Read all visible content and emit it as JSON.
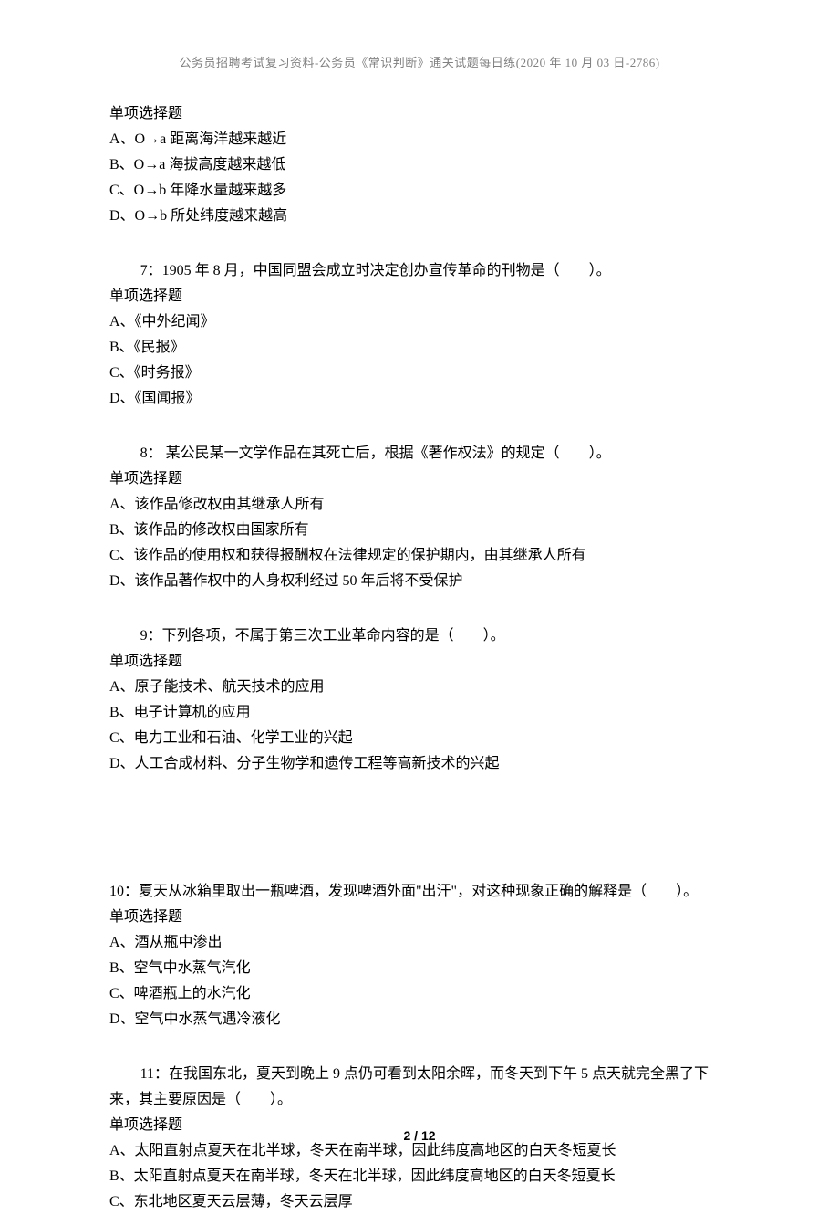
{
  "header": "公务员招聘考试复习资料-公务员《常识判断》通关试题每日练(2020 年 10 月 03 日-2786)",
  "q6": {
    "type": "单项选择题",
    "a": "A、O→a 距离海洋越来越近",
    "b": "B、O→a 海拔高度越来越低",
    "c": "C、O→b 年降水量越来越多",
    "d": "D、O→b 所处纬度越来越高"
  },
  "q7": {
    "text": "7：1905 年 8 月，中国同盟会成立时决定创办宣传革命的刊物是（　　）。",
    "type": "单项选择题",
    "a": "A、《中外纪闻》",
    "b": "B、《民报》",
    "c": "C、《时务报》",
    "d": "D、《国闻报》"
  },
  "q8": {
    "text": "8： 某公民某一文学作品在其死亡后，根据《著作权法》的规定（　　）。",
    "type": "单项选择题",
    "a": "A、该作品修改权由其继承人所有",
    "b": "B、该作品的修改权由国家所有",
    "c": "C、该作品的使用权和获得报酬权在法律规定的保护期内，由其继承人所有",
    "d": "D、该作品著作权中的人身权利经过 50 年后将不受保护"
  },
  "q9": {
    "text": "9：下列各项，不属于第三次工业革命内容的是（　　）。",
    "type": "单项选择题",
    "a": "A、原子能技术、航天技术的应用",
    "b": "B、电子计算机的应用",
    "c": "C、电力工业和石油、化学工业的兴起",
    "d": "D、人工合成材料、分子生物学和遗传工程等高新技术的兴起"
  },
  "q10": {
    "text": "10：夏天从冰箱里取出一瓶啤酒，发现啤酒外面\"出汗\"，对这种现象正确的解释是（　　）。",
    "type": "单项选择题",
    "a": "A、酒从瓶中渗出",
    "b": "B、空气中水蒸气汽化",
    "c": "C、啤酒瓶上的水汽化",
    "d": "D、空气中水蒸气遇冷液化"
  },
  "q11": {
    "text": "11：在我国东北，夏天到晚上 9 点仍可看到太阳余晖，而冬天到下午 5 点天就完全黑了下来，其主要原因是（　　）。",
    "type": "单项选择题",
    "a": "A、太阳直射点夏天在北半球，冬天在南半球，因此纬度高地区的白天冬短夏长",
    "b": "B、太阳直射点夏天在南半球，冬天在北半球，因此纬度高地区的白天冬短夏长",
    "c": "C、东北地区夏天云层薄，冬天云层厚"
  },
  "footer": "2 / 12"
}
